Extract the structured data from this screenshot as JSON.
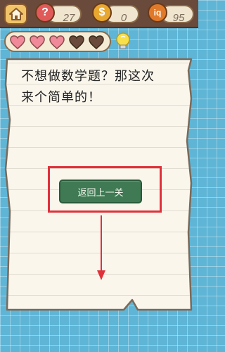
{
  "topbar": {
    "home_icon": "house-icon",
    "hints": {
      "icon": "question-mark-icon",
      "value": "27",
      "color": "#e05a5a"
    },
    "coins": {
      "icon": "dollar-coin-icon",
      "value": "0",
      "color": "#e8a830"
    },
    "iq": {
      "icon": "brain-iq-icon",
      "label": "iq",
      "value": "95",
      "color": "#e07a2a"
    }
  },
  "lives": {
    "hearts": [
      {
        "state": "full",
        "color": "#f08a9a"
      },
      {
        "state": "full",
        "color": "#f08a9a"
      },
      {
        "state": "full",
        "color": "#f08a9a"
      },
      {
        "state": "empty",
        "color": "#6a4a3a"
      },
      {
        "state": "empty",
        "color": "#6a4a3a"
      }
    ],
    "hint_icon": "lightbulb-icon"
  },
  "question": {
    "line1": "不想做数学题？那这次",
    "line2": "来个简单的！"
  },
  "back_button": {
    "label": "返回上一关"
  },
  "colors": {
    "highlight": "#e0303a",
    "button": "#3f7a54",
    "background": "#5fb5d6"
  }
}
